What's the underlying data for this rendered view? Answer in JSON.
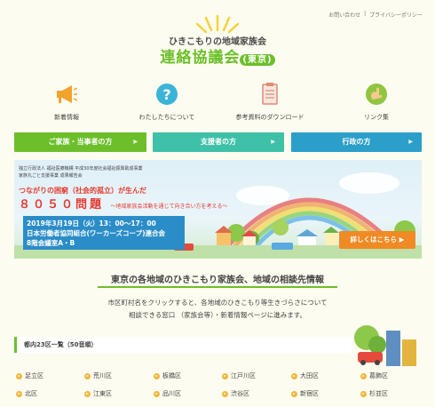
{
  "topnav": {
    "contact": "お問い合わせ",
    "separator": "|",
    "privacy": "プライバシーポリシー"
  },
  "logo": {
    "subtitle": "ひきこもりの地域家族会",
    "title": "連絡協議会",
    "region_badge": "東京"
  },
  "nav": [
    {
      "label": "新着情報",
      "icon": "megaphone-icon"
    },
    {
      "label": "わたしたちについて",
      "icon": "question-icon"
    },
    {
      "label": "参考資料のダウンロード",
      "icon": "clipboard-icon"
    },
    {
      "label": "リンク集",
      "icon": "hand-link-icon"
    }
  ],
  "categories": [
    {
      "label": "ご家族・当事者の方",
      "color": "#6cbf2a"
    },
    {
      "label": "支援者の方",
      "color": "#3fc0a8"
    },
    {
      "label": "行政の方",
      "color": "#2b9fc9"
    }
  ],
  "banner": {
    "line1": "独立行政法人 福祉医療機構 平成30年度社会福祉振興助成事業",
    "line2": "家族丸ごと支援事業 成果報告会",
    "headline": "つながりの困窮（社会的孤立）が生んだ",
    "big": "８０５０問題",
    "big_sub": "〜地域家族会活動を通じて向き合い方を考える〜",
    "date": "2019年3月19日（火）13：00〜17：00",
    "venue1": "日本労働者協同組合(ワーカーズコープ)連合会",
    "venue2": "8階会議室A・B",
    "more": "詳しくはこちら ▶",
    "sky_color": "#dff0f7",
    "accent_color": "#f08a24"
  },
  "info": {
    "title": "東京の各地域のひきこもり家族会、地域の相談先情報",
    "body1": "市区町村名をクリックすると、各地域のひきこもり等生きづらさについて",
    "body2": "相談できる窓口 （家族会等）・新着情報ページに進みます。"
  },
  "region": {
    "heading": "都内23区一覧（50音順）",
    "row1": [
      "足立区",
      "荒川区",
      "板橋区",
      "江戸川区",
      "大田区",
      "葛飾区"
    ],
    "row2": [
      "北区",
      "江東区",
      "品川区",
      "渋谷区",
      "新宿区",
      "杉並区"
    ]
  }
}
